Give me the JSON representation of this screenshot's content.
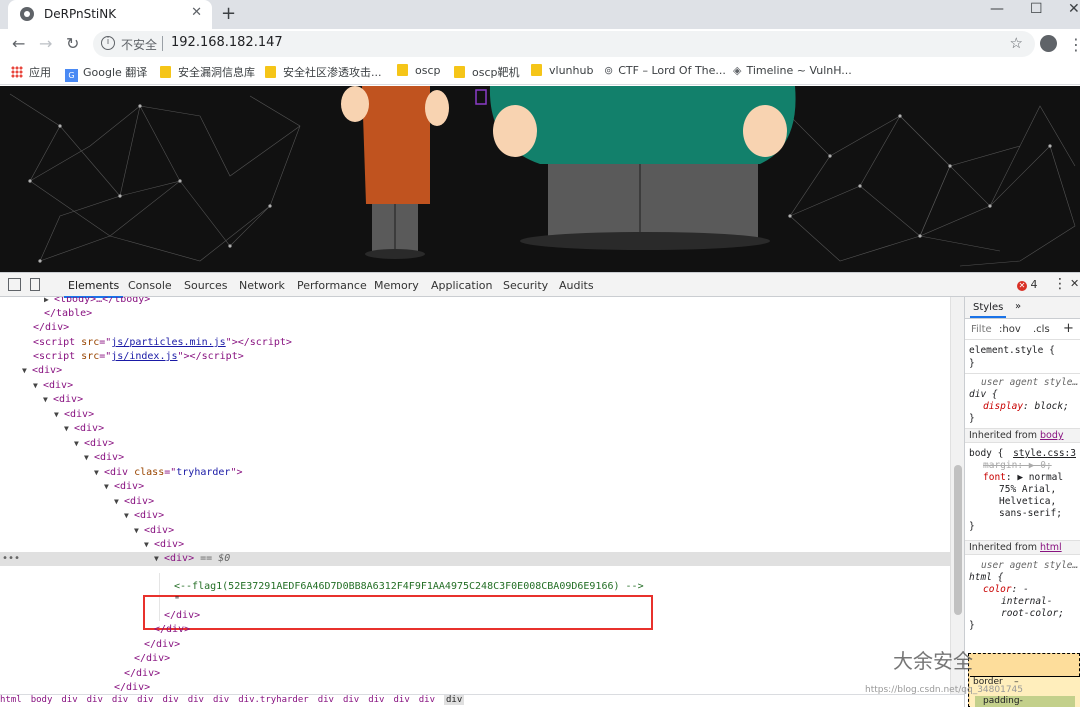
{
  "browser": {
    "tab_title": "DeRPnStiNK",
    "omnibox": {
      "security_label": "不安全",
      "url": "192.168.182.147"
    },
    "bookmarks": [
      {
        "label": "应用",
        "icon": "apps-grid-icon"
      },
      {
        "label": "Google 翻译",
        "icon": "google-translate-icon"
      },
      {
        "label": "安全漏洞信息库",
        "icon": "folder-icon"
      },
      {
        "label": "安全社区渗透攻击...",
        "icon": "folder-icon"
      },
      {
        "label": "oscp",
        "icon": "folder-icon"
      },
      {
        "label": "oscp靶机",
        "icon": "folder-icon"
      },
      {
        "label": "vlunhub",
        "icon": "folder-icon"
      },
      {
        "label": "CTF – Lord Of The...",
        "icon": "site-icon"
      },
      {
        "label": "Timeline ~ VulnH...",
        "icon": "site-icon"
      }
    ]
  },
  "devtools": {
    "tabs": [
      "Elements",
      "Console",
      "Sources",
      "Network",
      "Performance",
      "Memory",
      "Application",
      "Security",
      "Audits"
    ],
    "active_tab": "Elements",
    "error_count": "4",
    "dom_lines": [
      {
        "tbody": "<tbody>…</tbody>"
      },
      {
        "close_table": "</table>"
      },
      {
        "close_div": "</div>"
      },
      {
        "script1_src": "js/particles.min.js"
      },
      {
        "script2_src": "js/index.js"
      },
      {
        "selected_meta": "== $0"
      },
      {
        "div_class": "tryharder"
      },
      {
        "comment": "<--flag1(52E37291AEDF6A46D7D0BB8A6312F4F9F1AA4975C248C3F0E008CBA09D6E9166) -->"
      },
      {
        "quote": "\""
      }
    ],
    "breadcrumb": [
      "html",
      "body",
      "div",
      "div",
      "div",
      "div",
      "div",
      "div",
      "div",
      "div.tryharder",
      "div",
      "div",
      "div",
      "div",
      "div",
      "div"
    ],
    "styles": {
      "tab": "Styles",
      "filter_placeholder": "Filte",
      "hov": ":hov",
      "cls": ".cls",
      "element_style": "element.style {",
      "ua_label": "user agent style…",
      "div_selector": "div {",
      "display_prop": "display",
      "display_val": "block;",
      "inherited_body": "Inherited from",
      "inherited_body_tag": "body",
      "body_selector": "body {",
      "body_source": "style.css:3",
      "margin_prop": "margin",
      "margin_val": "0;",
      "font_prop": "font",
      "font_val": [
        "normal",
        "75% Arial,",
        "Helvetica,",
        "sans-serif;"
      ],
      "inherited_html": "Inherited from",
      "inherited_html_tag": "html",
      "html_selector": "html {",
      "color_prop": "color",
      "color_val": [
        "-",
        "internal-",
        "root-color;"
      ],
      "box_border": "border",
      "box_dash": "–",
      "box_padding": "padding-"
    }
  },
  "watermark": {
    "brand": "大余安全",
    "url": "https://blog.csdn.net/qq_34801745"
  },
  "colors": {
    "highlight_box": "#e8312c",
    "page_bg": "#111111",
    "shirt_teal": "#12806b",
    "dress_orange": "#c0531f"
  }
}
